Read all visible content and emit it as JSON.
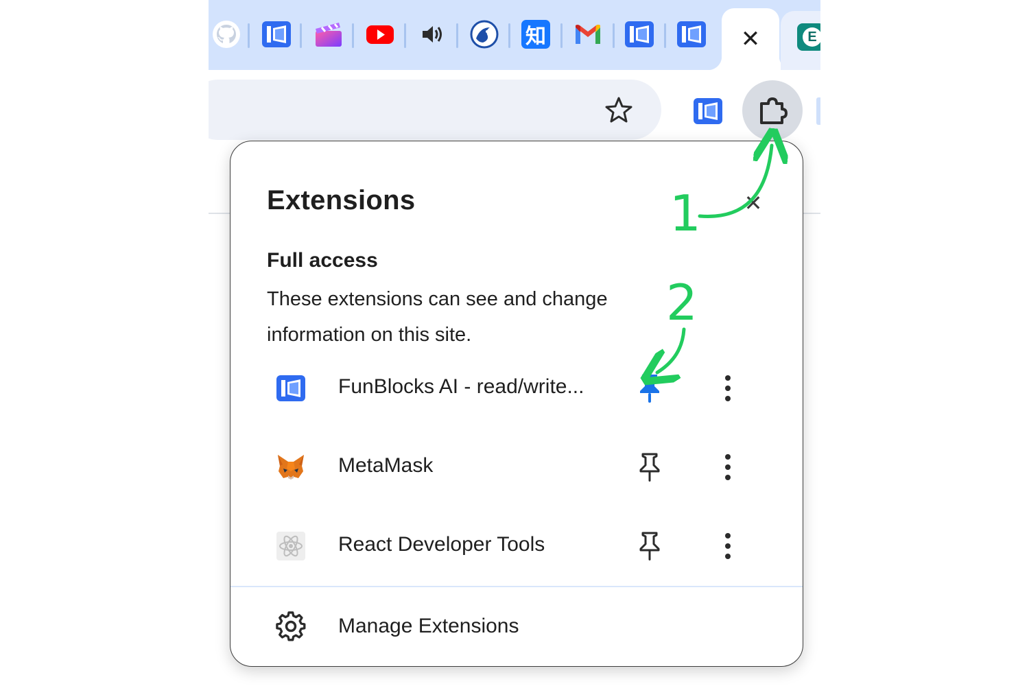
{
  "browser": {
    "active_tab": {
      "close_glyph": "✕"
    },
    "pinned_tabs": [
      {
        "icon": "github-icon"
      },
      {
        "icon": "funblocks-icon"
      },
      {
        "icon": "clapper-icon"
      },
      {
        "icon": "youtube-icon"
      },
      {
        "icon": "speaker-icon"
      },
      {
        "icon": "dolphin-icon"
      },
      {
        "icon": "zhihu-icon",
        "glyph": "知"
      },
      {
        "icon": "gmail-icon"
      },
      {
        "icon": "funblocks-icon"
      },
      {
        "icon": "funblocks-icon"
      }
    ],
    "partial_tab": {
      "icon": "e-badge-icon",
      "glyph": "E"
    },
    "toolbar": {
      "icons": [
        "star-icon",
        "funblocks-icon",
        "puzzle-icon"
      ]
    }
  },
  "popup": {
    "title": "Extensions",
    "close_glyph": "✕",
    "section": {
      "title": "Full access",
      "description": "These extensions can see and change information on this site."
    },
    "extensions": [
      {
        "name": "FunBlocks AI - read/write...",
        "icon": "funblocks-icon",
        "pinned": true
      },
      {
        "name": "MetaMask",
        "icon": "metamask-fox-icon",
        "pinned": false
      },
      {
        "name": "React Developer Tools",
        "icon": "react-icon",
        "pinned": false
      }
    ],
    "footer": {
      "label": "Manage Extensions",
      "icon": "gear-icon"
    }
  },
  "annotations": {
    "step1": "1",
    "step2": "2",
    "color": "#22cc5e"
  },
  "colors": {
    "tab_strip": "#d3e3fd",
    "pin_active": "#1a73e8",
    "funblocks": "#2f6bf0"
  }
}
